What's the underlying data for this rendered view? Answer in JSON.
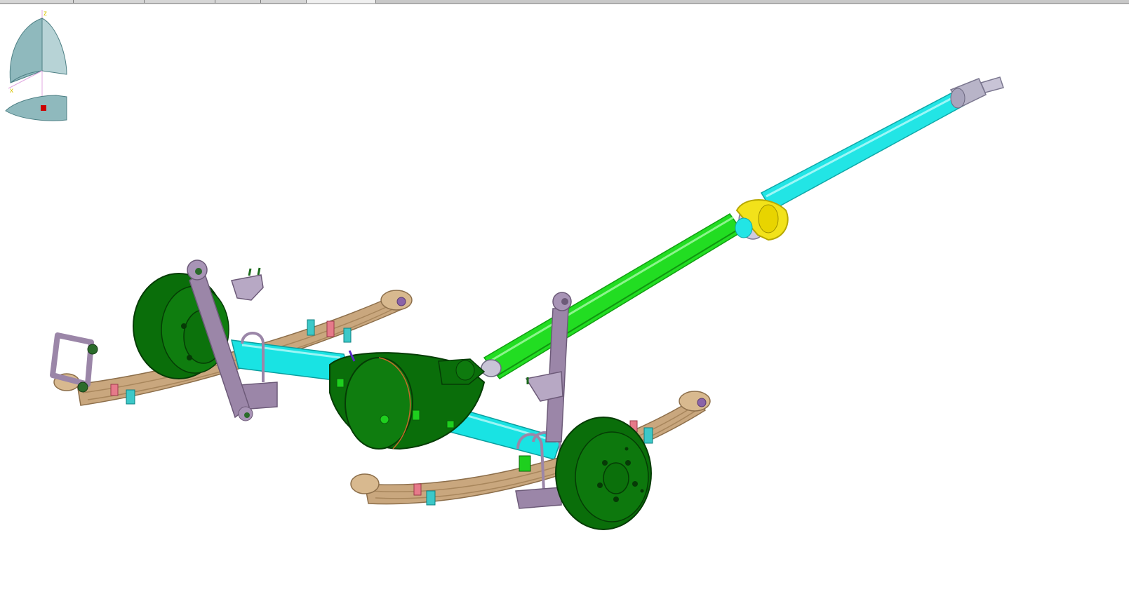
{
  "window": {
    "tab_count": 5,
    "active_tab_index": 4
  },
  "viewport": {
    "scene": "rear-axle-driveline-assembly",
    "background_color": "#ffffff"
  },
  "compass": {
    "axis_x_label": "x",
    "axis_z_label": "z",
    "axis_label_color": "#d9c400",
    "marker_color": "#cc0000"
  },
  "colors": {
    "housing_green": "#0a6e0a",
    "housing_green_light": "#1a8f1a",
    "axle_tube_cyan": "#19e3e3",
    "propshaft_green": "#22dd22",
    "propshaft_cyan": "#22e5e5",
    "spring_tan": "#c9a77e",
    "shock_purple": "#9b86a8",
    "flange_yellow": "#f2e21a",
    "yoke_gray": "#b8b4c8"
  }
}
